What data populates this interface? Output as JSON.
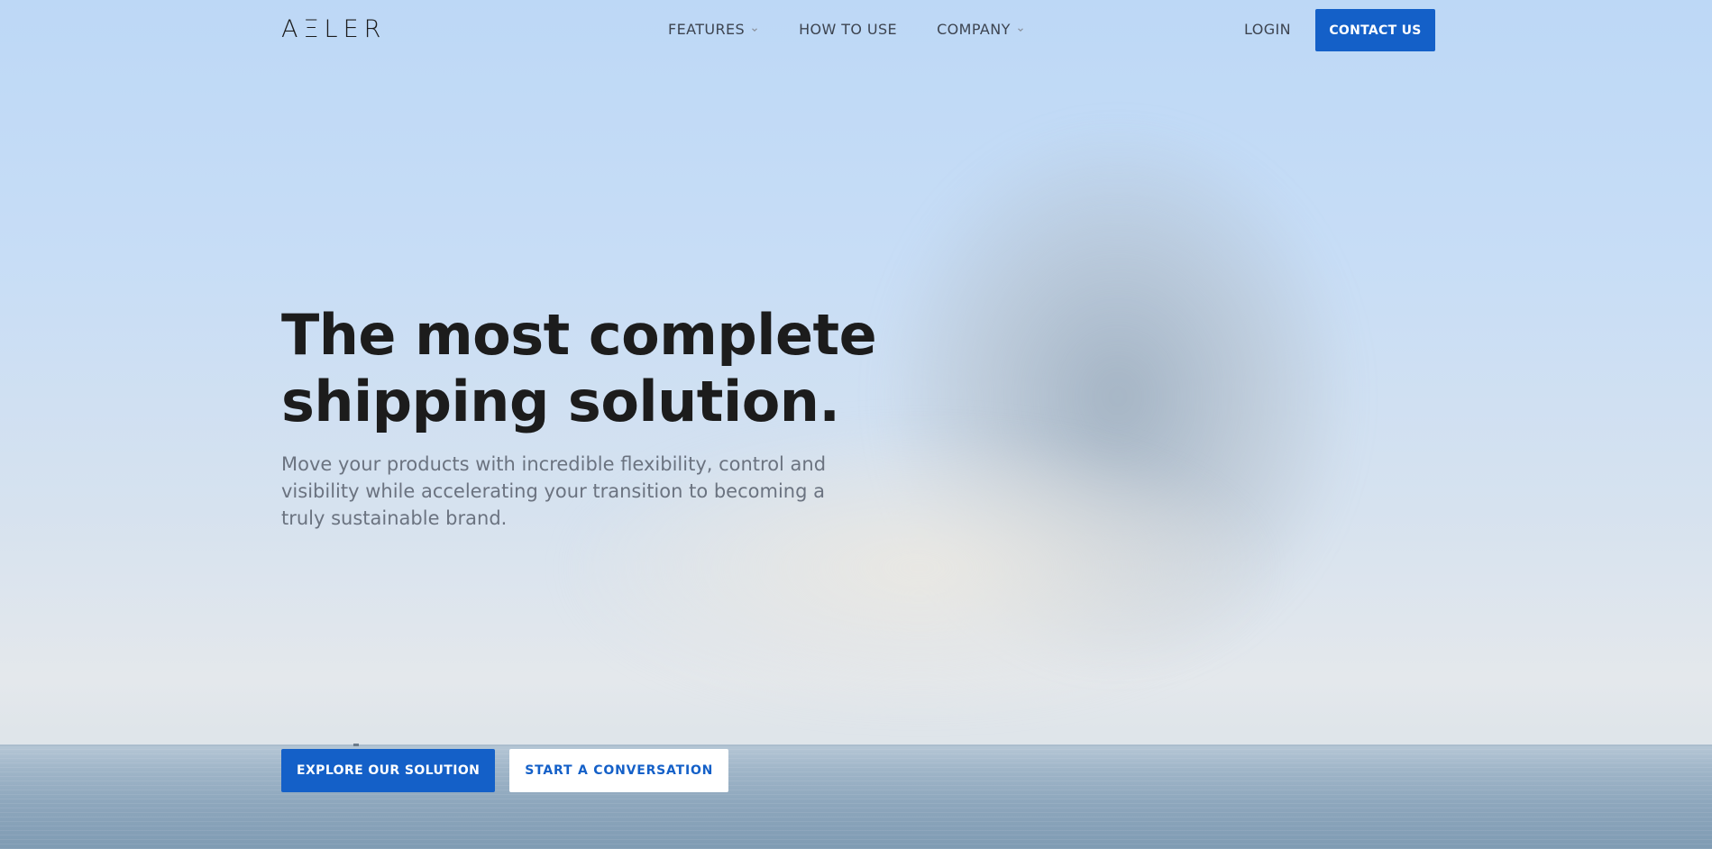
{
  "brand": {
    "logo_text": "AΞLER"
  },
  "nav": {
    "items": [
      {
        "label": "FEATURES",
        "has_dropdown": true
      },
      {
        "label": "HOW TO USE",
        "has_dropdown": false
      },
      {
        "label": "COMPANY",
        "has_dropdown": true
      }
    ],
    "login_label": "LOGIN",
    "contact_label": "CONTACT US"
  },
  "hero": {
    "title_line1": "The most complete",
    "title_line2": "shipping solution.",
    "subtitle": "Move your products with incredible flexibility, control and visibility while accelerating your transition to becoming a truly sustainable brand.",
    "primary_cta": "EXPLORE OUR SOLUTION",
    "secondary_cta": "START A CONVERSATION"
  },
  "colors": {
    "accent": "#1460c8",
    "heading": "#1c1c1c",
    "body_text": "#6b7380",
    "nav_text": "#3d4450"
  },
  "icons": {
    "dropdown": "chevron-down-icon"
  }
}
